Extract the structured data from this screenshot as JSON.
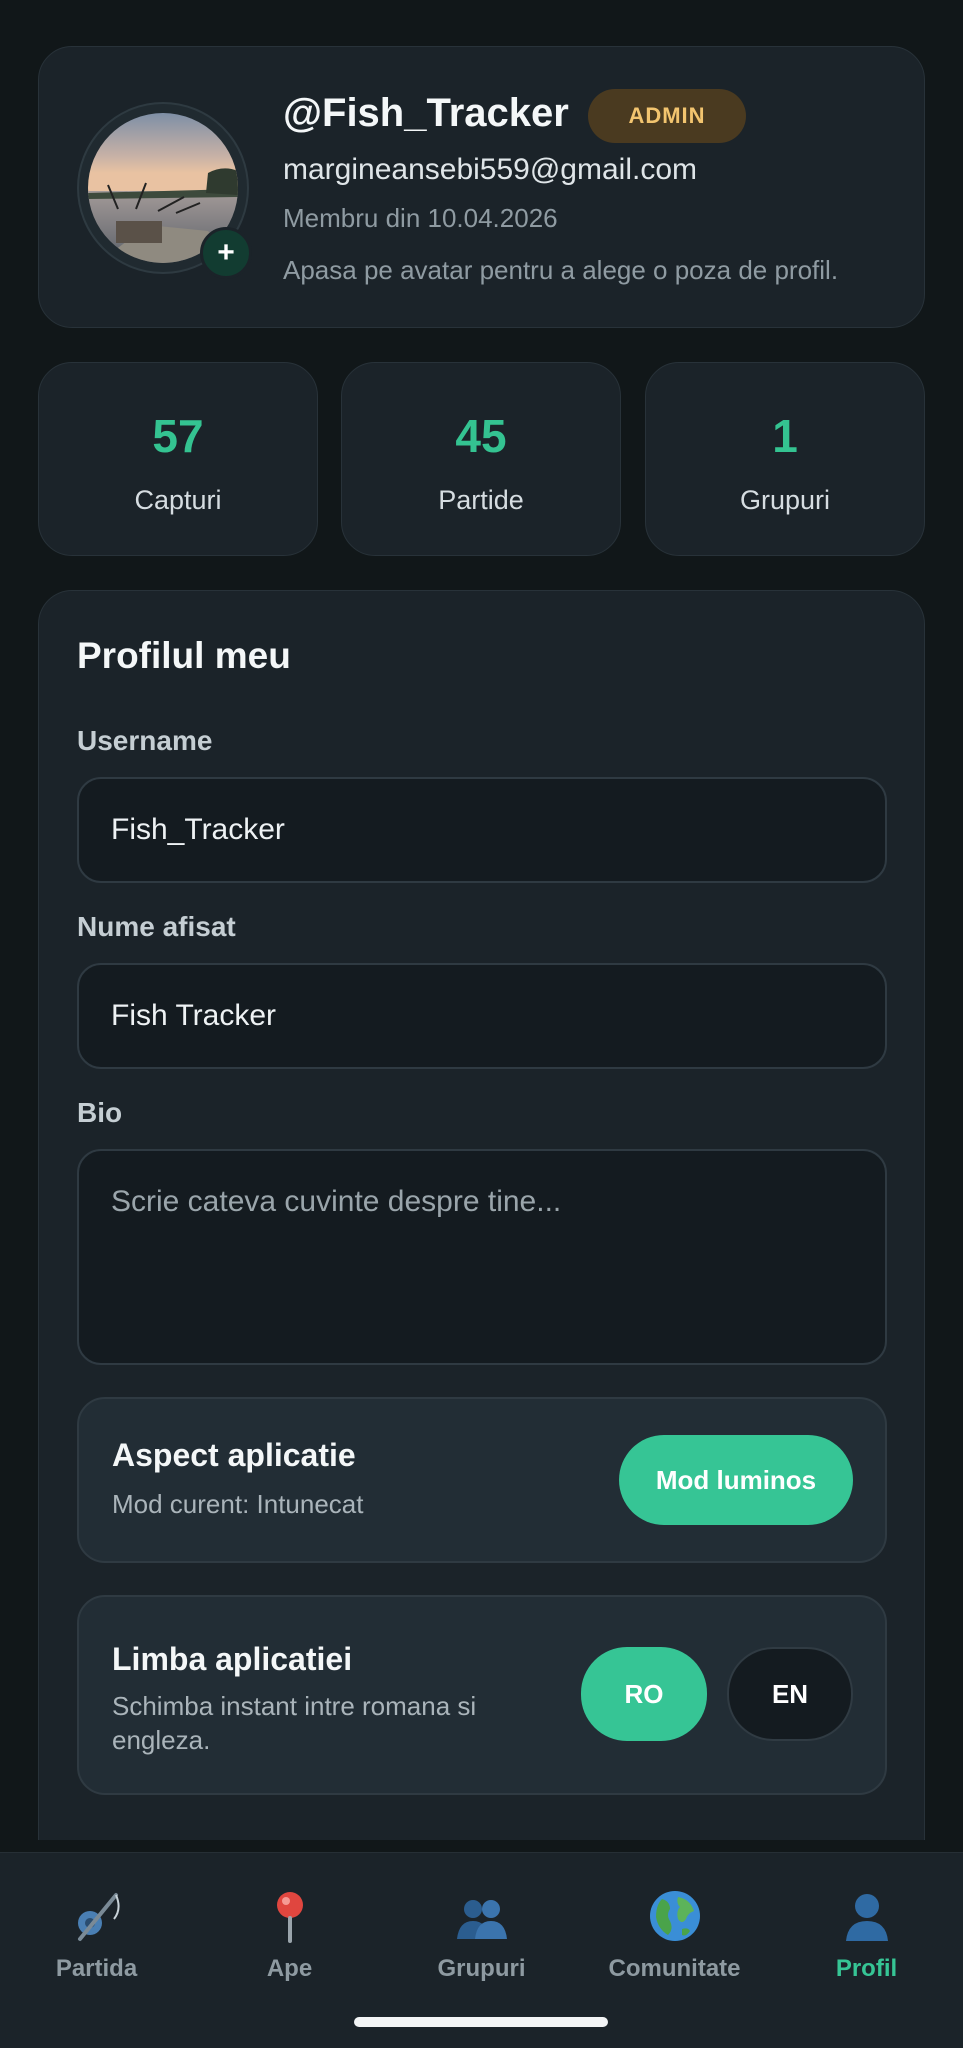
{
  "profile": {
    "handle": "@Fish_Tracker",
    "badge": "ADMIN",
    "email": "margineansebi559@gmail.com",
    "member_since": "Membru din 10.04.2026",
    "avatar_hint": "Apasa pe avatar pentru a alege o poza de profil.",
    "avatar_add_icon": "plus-icon"
  },
  "stats": [
    {
      "value": "57",
      "label": "Capturi"
    },
    {
      "value": "45",
      "label": "Partide"
    },
    {
      "value": "1",
      "label": "Grupuri"
    }
  ],
  "form": {
    "title": "Profilul meu",
    "username_label": "Username",
    "username_value": "Fish_Tracker",
    "display_name_label": "Nume afisat",
    "display_name_value": "Fish Tracker",
    "bio_label": "Bio",
    "bio_placeholder": "Scrie cateva cuvinte despre tine..."
  },
  "appearance": {
    "title": "Aspect aplicatie",
    "current": "Mod curent: Intunecat",
    "button": "Mod luminos"
  },
  "language": {
    "title": "Limba aplicatiei",
    "description": "Schimba instant intre romana si engleza.",
    "option_ro": "RO",
    "option_en": "EN",
    "selected": "RO"
  },
  "nav": [
    {
      "label": "Partida",
      "icon": "fishing-rod-icon"
    },
    {
      "label": "Ape",
      "icon": "map-pin-icon"
    },
    {
      "label": "Grupuri",
      "icon": "people-icon"
    },
    {
      "label": "Comunitate",
      "icon": "globe-icon"
    },
    {
      "label": "Profil",
      "icon": "person-icon",
      "active": true
    }
  ],
  "colors": {
    "background": "#111719",
    "card": "#1b2329",
    "accent": "#36c595",
    "badge_bg": "#4a3a20",
    "badge_text": "#f2c46f"
  }
}
